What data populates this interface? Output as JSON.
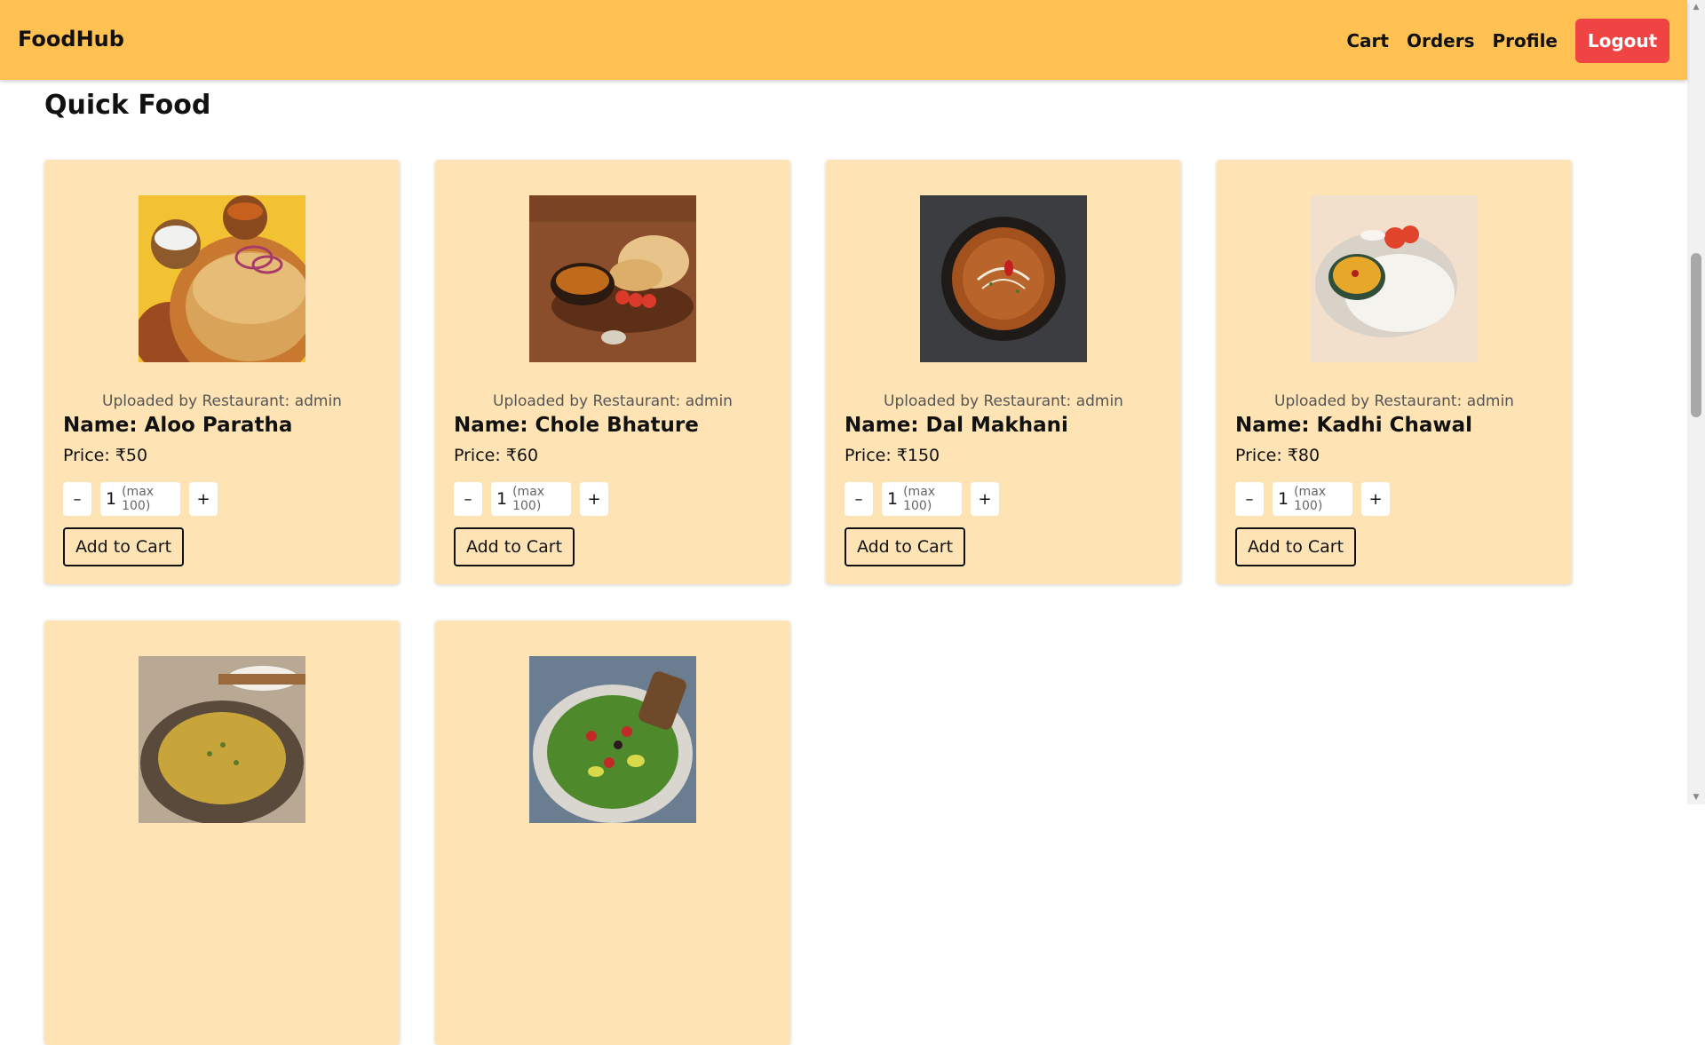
{
  "nav": {
    "brand": "FoodHub",
    "links": [
      "Cart",
      "Orders",
      "Profile"
    ],
    "logout_label": "Logout"
  },
  "section": {
    "title": "Quick Food"
  },
  "items": [
    {
      "uploader": "Uploaded by Restaurant: admin",
      "name": "Name: Aloo Paratha",
      "price": "Price: ₹50",
      "qty": "1",
      "qty_hint": "(max 100)",
      "minus": "–",
      "plus": "+",
      "add_label": "Add to Cart"
    },
    {
      "uploader": "Uploaded by Restaurant: admin",
      "name": "Name: Chole Bhature",
      "price": "Price: ₹60",
      "qty": "1",
      "qty_hint": "(max 100)",
      "minus": "–",
      "plus": "+",
      "add_label": "Add to Cart"
    },
    {
      "uploader": "Uploaded by Restaurant: admin",
      "name": "Name: Dal Makhani",
      "price": "Price: ₹150",
      "qty": "1",
      "qty_hint": "(max 100)",
      "minus": "–",
      "plus": "+",
      "add_label": "Add to Cart"
    },
    {
      "uploader": "Uploaded by Restaurant: admin",
      "name": "Name: Kadhi Chawal",
      "price": "Price: ₹80",
      "qty": "1",
      "qty_hint": "(max 100)",
      "minus": "–",
      "plus": "+",
      "add_label": "Add to Cart"
    }
  ],
  "colors": {
    "navbar": "#ffc151",
    "card": "#fee4b4",
    "logout": "#ef4444"
  }
}
